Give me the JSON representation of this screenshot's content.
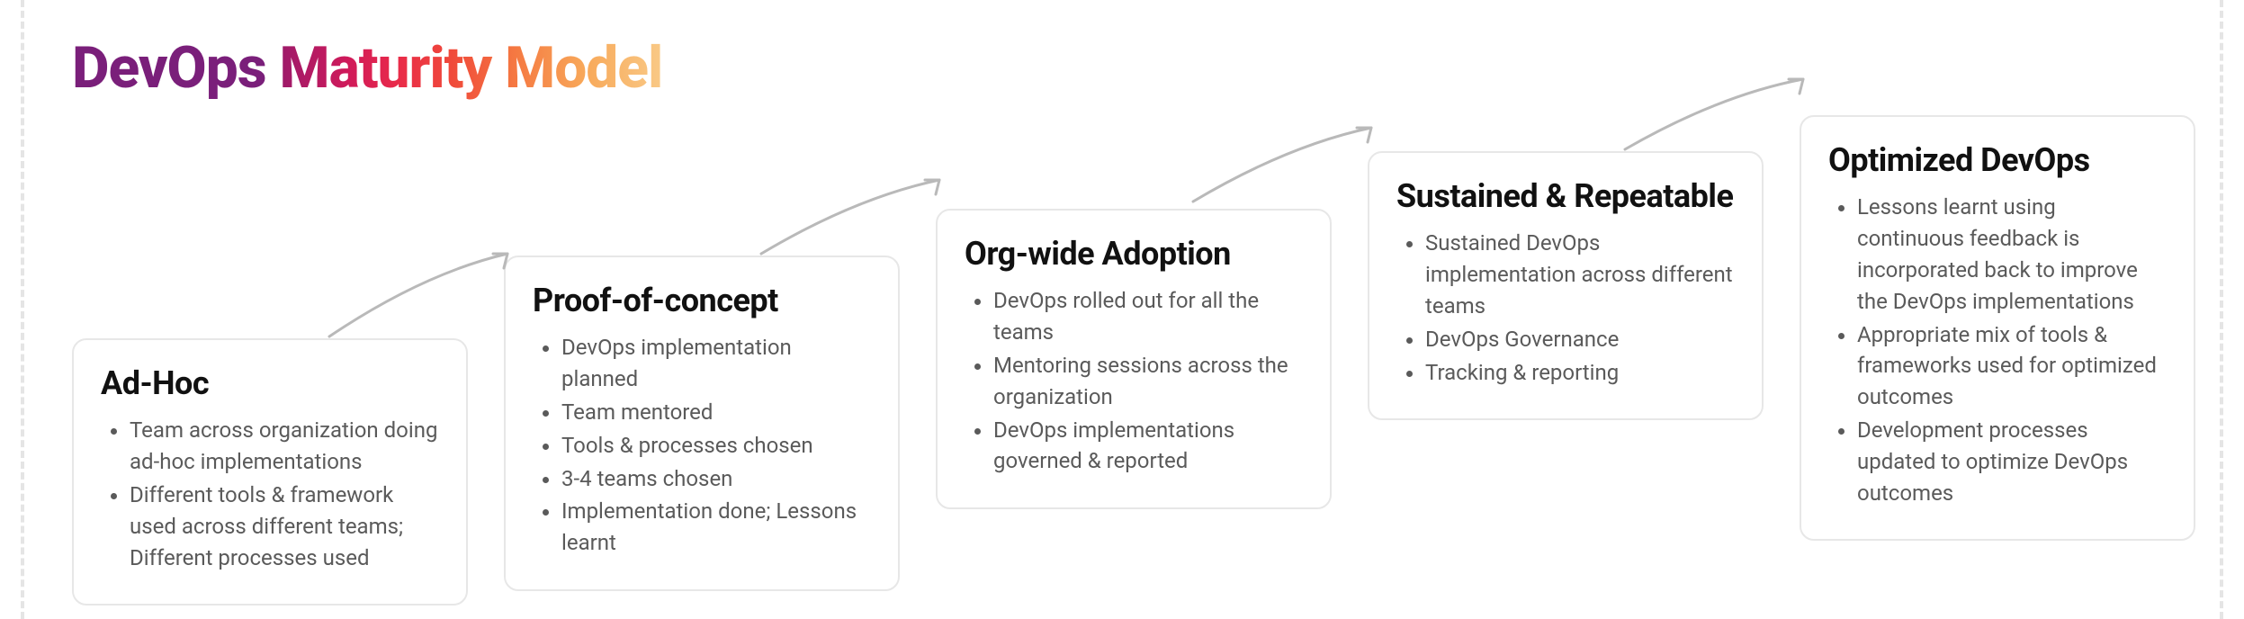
{
  "title": {
    "word1": "DevOps",
    "word2": "Maturity",
    "word3": "Model"
  },
  "stages": [
    {
      "heading": "Ad-Hoc",
      "points": [
        "Team across organization doing ad-hoc implementations",
        "Different tools & framework used across different teams; Different processes used"
      ]
    },
    {
      "heading": "Proof-of-concept",
      "points": [
        "DevOps implementation planned",
        "Team mentored",
        "Tools & processes chosen",
        "3-4 teams chosen",
        "Implementation done; Lessons learnt"
      ]
    },
    {
      "heading": "Org-wide Adoption",
      "points": [
        "DevOps rolled out for all the teams",
        "Mentoring sessions across the organization",
        "DevOps implementations governed & reported"
      ]
    },
    {
      "heading": "Sustained & Repeatable",
      "points": [
        "Sustained DevOps implementation across different teams",
        "DevOps Governance",
        "Tracking & reporting"
      ]
    },
    {
      "heading": "Optimized DevOps",
      "points": [
        "Lessons learnt using continuous feedback is incorporated back to improve the DevOps implementations",
        "Appropriate mix of tools & frameworks used for optimized outcomes",
        "Development processes updated to optimize DevOps outcomes"
      ]
    }
  ]
}
